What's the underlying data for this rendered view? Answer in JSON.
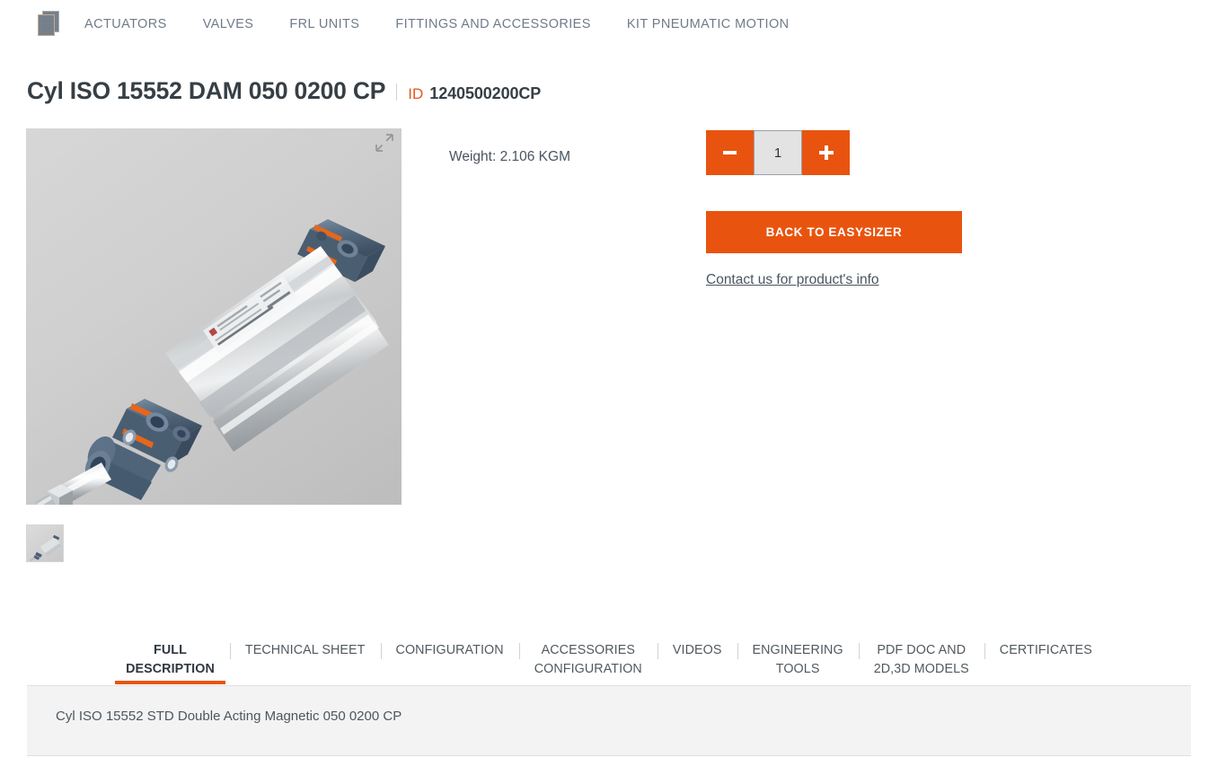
{
  "nav": {
    "brand_icon": "layers-icon",
    "items": [
      {
        "label": "ACTUATORS"
      },
      {
        "label": "VALVES"
      },
      {
        "label": "FRL UNITS"
      },
      {
        "label": "FITTINGS AND ACCESSORIES"
      },
      {
        "label": "KIT PNEUMATIC MOTION"
      }
    ]
  },
  "product": {
    "title": "Cyl ISO 15552 DAM 050 0200 CP",
    "id_label": "ID",
    "id_value": "1240500200CP",
    "weight": "Weight: 2.106 KGM",
    "image_alt": "pneumatic-cylinder-iso-15552",
    "thumbnail_alt": "pneumatic-cylinder-thumbnail",
    "expand_icon": "expand-arrows-icon"
  },
  "purchase": {
    "decrease_label": "-",
    "increase_label": "+",
    "quantity": "1",
    "cta_label": "BACK TO EASYSIZER",
    "contact_link": "Contact us for product's info"
  },
  "tabs": [
    {
      "line1": "FULL",
      "line2": "DESCRIPTION",
      "active": true
    },
    {
      "line1": "TECHNICAL SHEET",
      "line2": "",
      "active": false
    },
    {
      "line1": "CONFIGURATION",
      "line2": "",
      "active": false
    },
    {
      "line1": "ACCESSORIES",
      "line2": "CONFIGURATION",
      "active": false
    },
    {
      "line1": "VIDEOS",
      "line2": "",
      "active": false
    },
    {
      "line1": "ENGINEERING",
      "line2": "TOOLS",
      "active": false
    },
    {
      "line1": "PDF DOC AND",
      "line2": "2D,3D MODELS",
      "active": false
    },
    {
      "line1": "CERTIFICATES",
      "line2": "",
      "active": false
    }
  ],
  "description": {
    "text": "Cyl ISO 15552 STD Double Acting Magnetic 050 0200 CP"
  },
  "colors": {
    "accent_orange": "#e8540f",
    "nav_text": "#6f7b8a",
    "title_text": "#363f45",
    "panel_bg": "#f3f3f3"
  }
}
